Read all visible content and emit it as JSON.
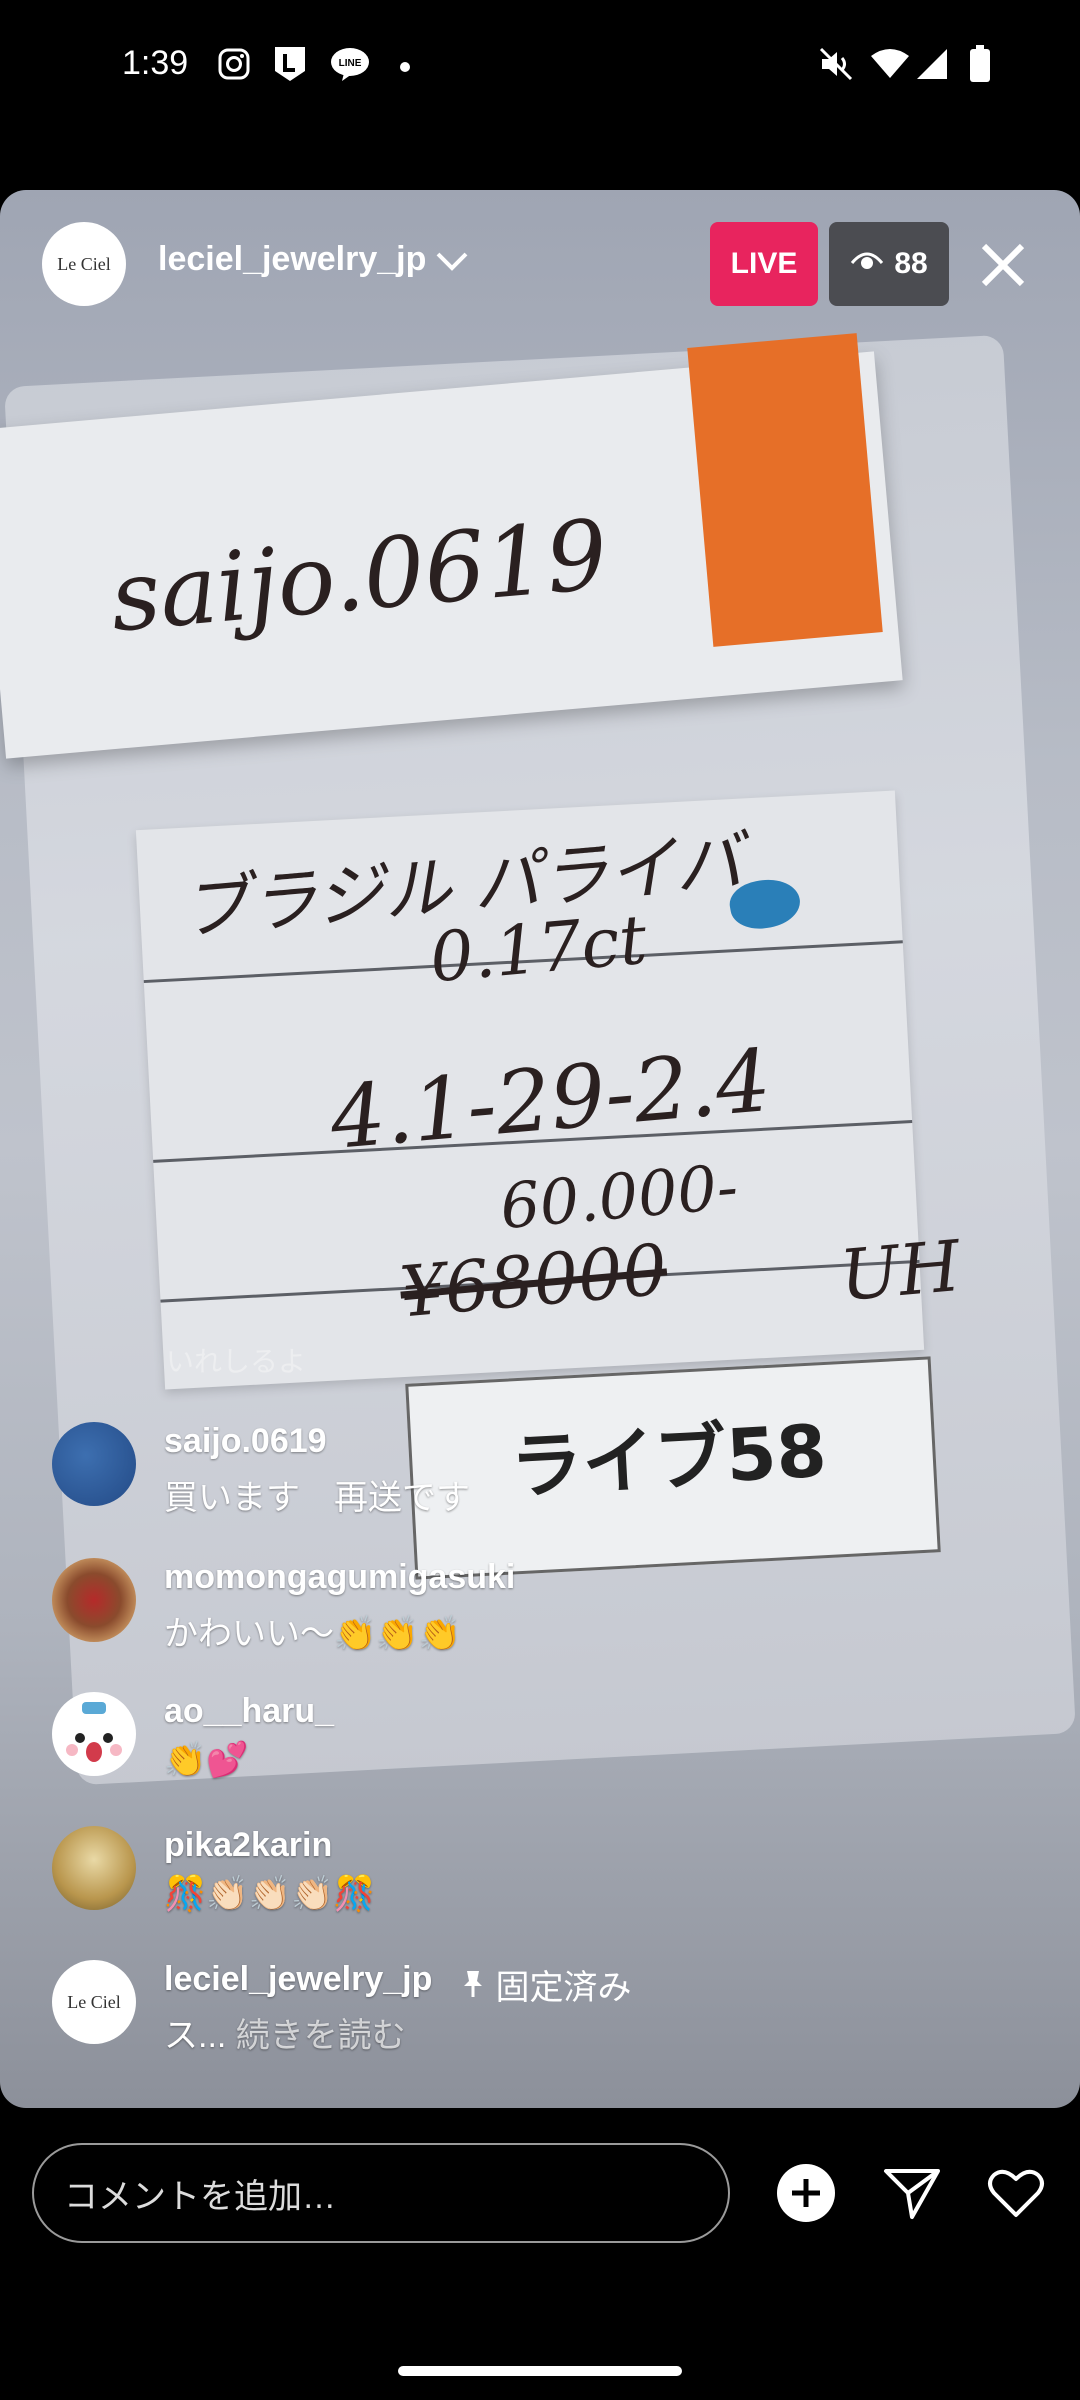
{
  "status_bar": {
    "time": "1:39",
    "icons": [
      "instagram-icon",
      "line-l-icon",
      "line-chat-icon",
      "dot-icon",
      "mute-icon",
      "wifi-icon",
      "signal-icon",
      "battery-icon"
    ]
  },
  "live": {
    "account": "leciel_jewelry_jp",
    "avatar_text": "Le Ciel",
    "live_badge": "LIVE",
    "viewer_count": "88"
  },
  "video_text": {
    "top_label": "saijo.0619",
    "line1": "ブラジル パライバ",
    "line2": "0.17ct",
    "line3": "4.1-29-2.4",
    "line4": "60.000-",
    "line5": "¥68000",
    "line6": "UH",
    "sticker": "ライブ58"
  },
  "comments": {
    "faded_text": "いれしるよ",
    "items": [
      {
        "user": "saijo.0619",
        "text": "買います　再送です"
      },
      {
        "user": "momongagumigasuki",
        "text": "かわいい〜👏👏👏"
      },
      {
        "user": "ao__haru_",
        "text": "👏💕"
      },
      {
        "user": "pika2karin",
        "text": "🎊👏🏻👏🏻👏🏻🎊"
      }
    ],
    "pinned": {
      "user": "leciel_jewelry_jp",
      "pinned_label": "固定済み",
      "text": "ス...",
      "read_more": "続きを読む"
    }
  },
  "bottom_bar": {
    "comment_placeholder": "コメントを追加…"
  },
  "colors": {
    "live_red": "#e8245e",
    "background": "#000000"
  }
}
